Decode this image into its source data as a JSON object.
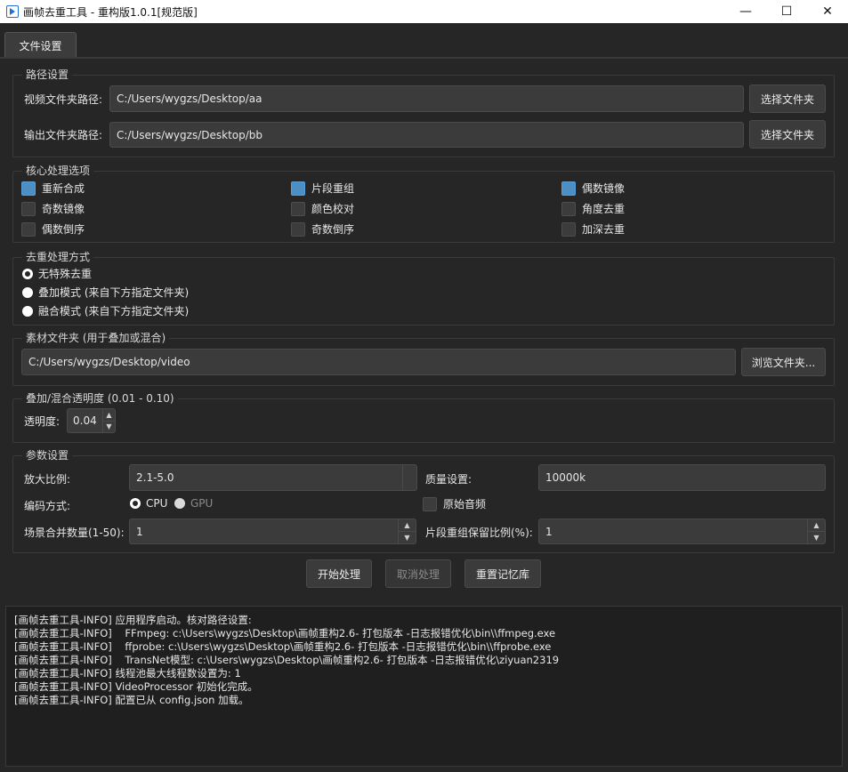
{
  "window": {
    "title": "画帧去重工具 - 重构版1.0.1[规范版]",
    "minimize": "—",
    "maximize": "☐",
    "close": "✕"
  },
  "tabs": [
    {
      "label": "文件设置"
    }
  ],
  "paths": {
    "group_title": "路径设置",
    "video_label": "视频文件夹路径:",
    "video_value": "C:/Users/wygzs/Desktop/aa",
    "video_button": "选择文件夹",
    "output_label": "输出文件夹路径:",
    "output_value": "C:/Users/wygzs/Desktop/bb",
    "output_button": "选择文件夹"
  },
  "core": {
    "group_title": "核心处理选项",
    "options": [
      {
        "label": "重新合成",
        "checked": true
      },
      {
        "label": "片段重组",
        "checked": true
      },
      {
        "label": "偶数镜像",
        "checked": true
      },
      {
        "label": "奇数镜像",
        "checked": false
      },
      {
        "label": "颜色校对",
        "checked": false
      },
      {
        "label": "角度去重",
        "checked": false
      },
      {
        "label": "偶数倒序",
        "checked": false
      },
      {
        "label": "奇数倒序",
        "checked": false
      },
      {
        "label": "加深去重",
        "checked": false
      }
    ]
  },
  "dedup": {
    "group_title": "去重处理方式",
    "options": [
      {
        "label": "无特殊去重",
        "selected": true
      },
      {
        "label": "叠加模式 (来自下方指定文件夹)",
        "selected": false
      },
      {
        "label": "融合模式 (来自下方指定文件夹)",
        "selected": false
      }
    ]
  },
  "material": {
    "group_title": "素材文件夹 (用于叠加或混合)",
    "path": "C:/Users/wygzs/Desktop/video",
    "browse_button": "浏览文件夹..."
  },
  "opacity": {
    "group_title": "叠加/混合透明度 (0.01 - 0.10)",
    "label": "透明度:",
    "value": "0.04"
  },
  "params": {
    "group_title": "参数设置",
    "zoom_label": "放大比例:",
    "zoom_value": "2.1-5.0",
    "quality_label": "质量设置:",
    "quality_value": "10000k",
    "encode_label": "编码方式:",
    "encode_cpu": "CPU",
    "encode_gpu": "GPU",
    "original_audio": "原始音频",
    "scene_label": "场景合并数量(1-50):",
    "scene_value": "1",
    "keep_label": "片段重组保留比例(%):",
    "keep_value": "1"
  },
  "actions": {
    "start": "开始处理",
    "cancel": "取消处理",
    "reset": "重置记忆库"
  },
  "log_lines": [
    "[画帧去重工具-INFO] 应用程序启动。核对路径设置:",
    "[画帧去重工具-INFO]    FFmpeg: c:\\Users\\wygzs\\Desktop\\画帧重构2.6- 打包版本 -日志报错优化\\bin\\\\ffmpeg.exe",
    "[画帧去重工具-INFO]    ffprobe: c:\\Users\\wygzs\\Desktop\\画帧重构2.6- 打包版本 -日志报错优化\\bin\\\\ffprobe.exe",
    "[画帧去重工具-INFO]    TransNet模型: c:\\Users\\wygzs\\Desktop\\画帧重构2.6- 打包版本 -日志报错优化\\ziyuan2319",
    "[画帧去重工具-INFO] 线程池最大线程数设置为: 1",
    "[画帧去重工具-INFO] VideoProcessor 初始化完成。",
    "[画帧去重工具-INFO] 配置已从 config.json 加载。"
  ]
}
